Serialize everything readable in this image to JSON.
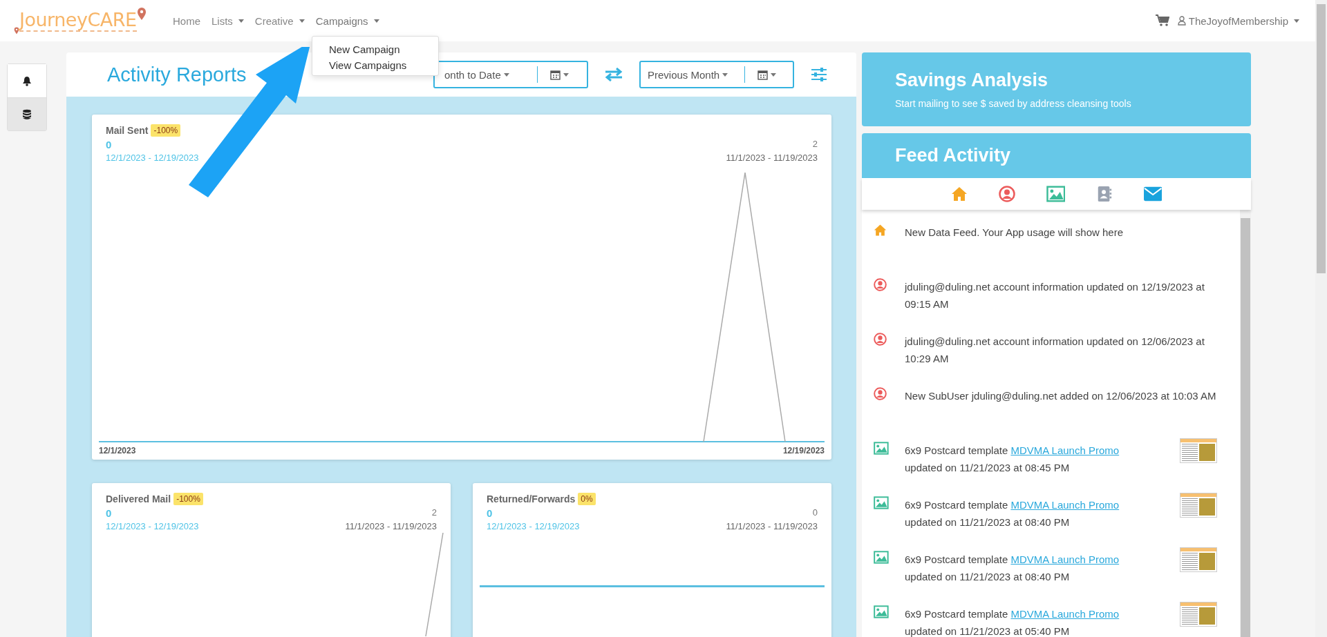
{
  "navbar": {
    "logo": "JourneyCARE",
    "items": [
      {
        "label": "Home",
        "has_menu": false,
        "expanded": false
      },
      {
        "label": "Lists",
        "has_menu": true,
        "expanded": false
      },
      {
        "label": "Creative",
        "has_menu": true,
        "expanded": false
      },
      {
        "label": "Campaigns",
        "has_menu": true,
        "expanded": true
      }
    ],
    "menu": [
      "New Campaign",
      "View Campaigns"
    ],
    "user": "TheJoyofMembership"
  },
  "side_buttons": [
    {
      "kind": "bell",
      "selected": false
    },
    {
      "kind": "database",
      "selected": true
    }
  ],
  "activity": {
    "title": "Activity Reports",
    "period_1": "onth to Date",
    "period_2": "Previous Month"
  },
  "cards": [
    {
      "title": "Mail Sent",
      "change": "-100%",
      "current": "0",
      "current_range": "12/1/2023 - 12/19/2023",
      "previous": "2",
      "previous_range": "11/1/2023 - 11/19/2023",
      "x_start": "12/1/2023",
      "x_end": "12/19/2023"
    },
    {
      "title": "Delivered Mail",
      "change": "-100%",
      "current": "0",
      "current_range": "12/1/2023 - 12/19/2023",
      "previous": "2",
      "previous_range": "11/1/2023 - 11/19/2023"
    },
    {
      "title": "Returned/Forwards",
      "change": "0%",
      "current": "0",
      "current_range": "12/1/2023 - 12/19/2023",
      "previous": "0",
      "previous_range": "11/1/2023 - 11/19/2023"
    }
  ],
  "savings": {
    "title": "Savings Analysis",
    "text": "Start mailing to see $ saved by address cleansing tools"
  },
  "feed": {
    "title": "Feed Activity",
    "items": [
      {
        "kind": "home",
        "text": "New Data Feed. Your App usage will show here"
      },
      {
        "kind": "user",
        "text": "jduling@duling.net account information updated on 12/19/2023 at 09:15 AM"
      },
      {
        "kind": "user",
        "text": "jduling@duling.net account information updated on 12/06/2023 at 10:29 AM"
      },
      {
        "kind": "user",
        "text": "New SubUser jduling@duling.net added on 12/06/2023 at 10:03 AM"
      },
      {
        "kind": "image",
        "text": "6x9 Postcard template",
        "link": "MDVMA Launch Promo",
        "after": "updated on 11/21/2023 at 08:45 PM"
      },
      {
        "kind": "image",
        "text": "6x9 Postcard template",
        "link": "MDVMA Launch Promo",
        "after": "updated on 11/21/2023 at 08:40 PM"
      },
      {
        "kind": "image",
        "text": "6x9 Postcard template",
        "link": "MDVMA Launch Promo",
        "after": "updated on 11/21/2023 at 08:40 PM"
      },
      {
        "kind": "image",
        "text": "6x9 Postcard template",
        "link": "MDVMA Launch Promo",
        "after": "updated on 11/21/2023 at 05:40 PM"
      }
    ]
  }
}
